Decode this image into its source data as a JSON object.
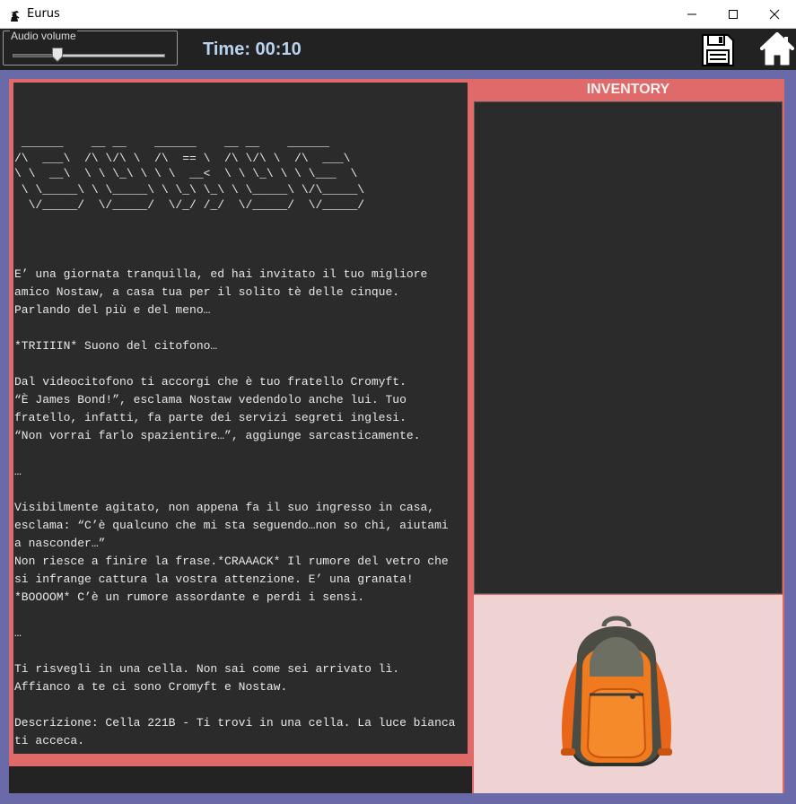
{
  "window": {
    "title": "Eurus"
  },
  "toolbar": {
    "audio_label": "Audio volume",
    "audio_volume": 0.3,
    "time_text": "Time: 00:10"
  },
  "story": {
    "ascii_art": [
      " ______    __ __    ______    __ __    ______",
      "/\\  ___\\  /\\ \\/\\ \\  /\\  == \\  /\\ \\/\\ \\  /\\  ___\\",
      "\\ \\  __\\  \\ \\ \\_\\ \\ \\ \\  __<  \\ \\ \\_\\ \\ \\ \\___  \\",
      " \\ \\_____\\ \\ \\_____\\ \\ \\_\\ \\_\\ \\ \\_____\\ \\/\\_____\\",
      "  \\/_____/  \\/_____/  \\/_/ /_/  \\/_____/  \\/_____/"
    ],
    "lines": [
      "E’ una giornata tranquilla, ed hai invitato il tuo migliore",
      "amico Nostaw, a casa tua per il solito tè delle cinque.",
      "Parlando del più e del meno…",
      "",
      "*TRIIIIN* Suono del citofono…",
      "",
      "Dal videocitofono ti accorgi che è tuo fratello Cromyft.",
      "“È James Bond!”, esclama Nostaw vedendolo anche lui. Tuo",
      "fratello, infatti, fa parte dei servizi segreti inglesi.",
      "“Non vorrai farlo spazientire…”, aggiunge sarcasticamente.",
      "",
      "…",
      "",
      "Visibilmente agitato, non appena fa il suo ingresso in casa,",
      "esclama: “C’è qualcuno che mi sta seguendo…non so chi, aiutami",
      "a nasconder…”",
      "Non riesce a finire la frase.*CRAAACK* Il rumore del vetro che",
      "si infrange cattura la vostra attenzione. E’ una granata!",
      "*BOOOOM* C’è un rumore assordante e perdi i sensi.",
      "",
      "…",
      "",
      "Ti risvegli in una cella. Non sai come sei arrivato lì.",
      "Affianco a te ci sono Cromyft e Nostaw.",
      "",
      "Descrizione: Cella 221B - Ti trovi in una cella. La luce bianca",
      "ti acceca."
    ]
  },
  "inventory": {
    "header": "INVENTORY",
    "items": [],
    "image_icon": "backpack-icon"
  },
  "colors": {
    "frame_accent": "#e06a6a",
    "background": "#6b6aa8",
    "panel_dark": "#2b2b2b",
    "time_text": "#b9d2ee"
  }
}
